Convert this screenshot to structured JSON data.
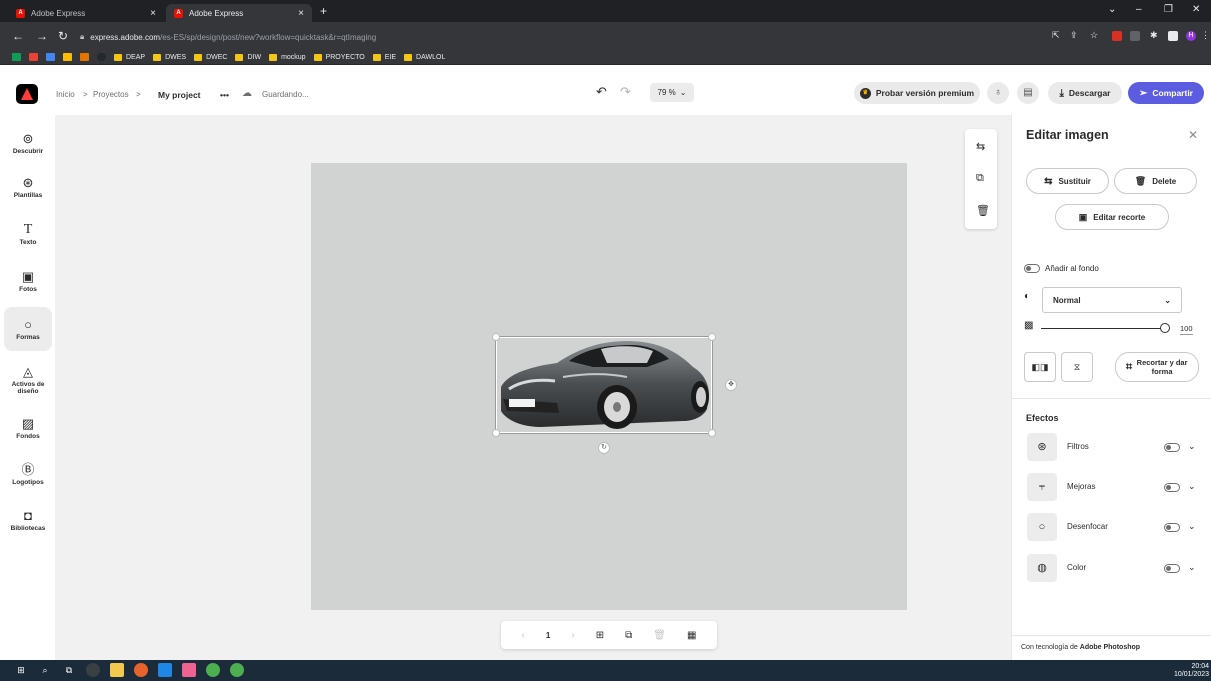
{
  "browser": {
    "tabs": [
      {
        "title": "Adobe Express",
        "active": false
      },
      {
        "title": "Adobe Express",
        "active": true
      }
    ],
    "new_tab": "+",
    "url_host": "express.adobe.com",
    "url_path": "/es-ES/sp/design/post/new?workflow=quicktask&r=qtImaging",
    "profile_initial": "H",
    "bookmarks": [
      "DEAP",
      "DWES",
      "DWEC",
      "DIW",
      "mockup",
      "PROYECTO",
      "EIE",
      "DAWLOL"
    ]
  },
  "header": {
    "breadcrumb": [
      "Inicio",
      "Proyectos"
    ],
    "separator": ">",
    "project_name": "My project",
    "more": "•••",
    "saving_status": "Guardando...",
    "zoom": "79 %",
    "premium_label": "Probar versión premium",
    "download_label": "Descargar",
    "share_label": "Compartir"
  },
  "left_rail": [
    {
      "label": "Descubrir",
      "icon": "discover-icon",
      "glyph": "⊚"
    },
    {
      "label": "Plantillas",
      "icon": "templates-icon",
      "glyph": "⊛"
    },
    {
      "label": "Texto",
      "icon": "text-icon",
      "glyph": "T"
    },
    {
      "label": "Fotos",
      "icon": "photos-icon",
      "glyph": "▣"
    },
    {
      "label": "Formas",
      "icon": "shapes-icon",
      "glyph": "○",
      "active": true
    },
    {
      "label": "Activos de diseño",
      "icon": "design-assets-icon",
      "glyph": "◬"
    },
    {
      "label": "Fondos",
      "icon": "backgrounds-icon",
      "glyph": "▨"
    },
    {
      "label": "Logotipos",
      "icon": "logos-icon",
      "glyph": "Ⓑ"
    },
    {
      "label": "Bibliotecas",
      "icon": "libraries-icon",
      "glyph": "◘"
    }
  ],
  "page_nav": {
    "page": "1"
  },
  "panel": {
    "title": "Editar imagen",
    "replace_label": "Sustituir",
    "delete_label": "Delete",
    "edit_crop_label": "Editar recorte",
    "add_to_bg_label": "Añadir al fondo",
    "blend_mode": "Normal",
    "opacity": "100",
    "opacity_fraction": 1.0,
    "crop_shape_label": "Recortar y dar forma",
    "effects_title": "Efectos",
    "effects": [
      {
        "label": "Filtros",
        "icon": "filters-icon",
        "glyph": "⊛"
      },
      {
        "label": "Mejoras",
        "icon": "adjustments-icon",
        "glyph": "⫧"
      },
      {
        "label": "Desenfocar",
        "icon": "blur-icon",
        "glyph": "○"
      },
      {
        "label": "Color",
        "icon": "color-icon",
        "glyph": "◍"
      }
    ],
    "powered_prefix": "Con tecnología de ",
    "powered_brand": "Adobe Photoshop"
  },
  "taskbar": {
    "time": "20:04",
    "date": "10/01/2023"
  },
  "colors": {
    "accent": "#5c5ce0",
    "brand": "#eb1000"
  }
}
